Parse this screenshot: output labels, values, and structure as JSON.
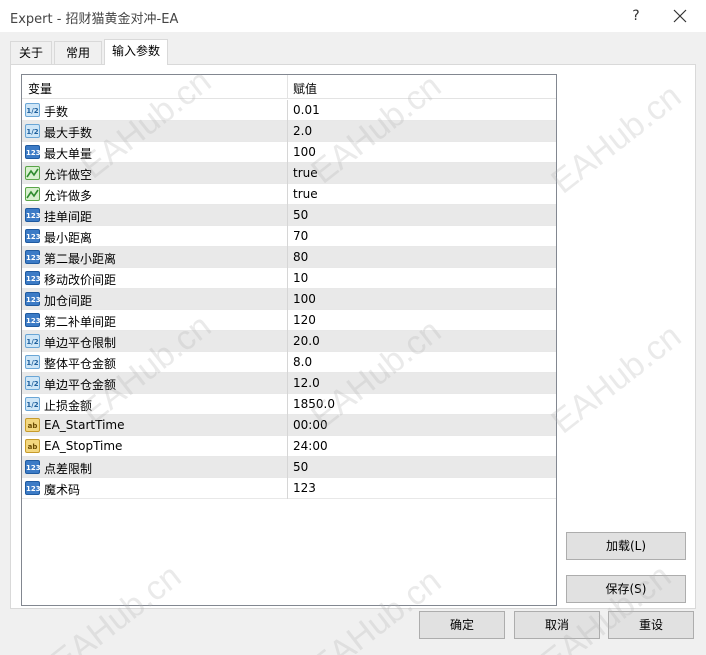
{
  "window": {
    "title": "Expert - 招财猫黄金对冲-EA",
    "help": "?"
  },
  "tabs": [
    {
      "label": "关于"
    },
    {
      "label": "常用"
    },
    {
      "label": "输入参数"
    }
  ],
  "grid": {
    "col_variable": "变量",
    "col_value": "赋值",
    "rows": [
      {
        "name": "手数",
        "value": "0.01",
        "type": "double"
      },
      {
        "name": "最大手数",
        "value": "2.0",
        "type": "double"
      },
      {
        "name": "最大单量",
        "value": "100",
        "type": "int"
      },
      {
        "name": "允许做空",
        "value": "true",
        "type": "bool"
      },
      {
        "name": "允许做多",
        "value": "true",
        "type": "bool"
      },
      {
        "name": "挂单间距",
        "value": "50",
        "type": "int"
      },
      {
        "name": "最小距离",
        "value": "70",
        "type": "int"
      },
      {
        "name": "第二最小距离",
        "value": "80",
        "type": "int"
      },
      {
        "name": "移动改价间距",
        "value": "10",
        "type": "int"
      },
      {
        "name": "加仓间距",
        "value": "100",
        "type": "int"
      },
      {
        "name": "第二补单间距",
        "value": "120",
        "type": "int"
      },
      {
        "name": "单边平仓限制",
        "value": "20.0",
        "type": "double"
      },
      {
        "name": "整体平仓金额",
        "value": "8.0",
        "type": "double"
      },
      {
        "name": "单边平仓金额",
        "value": "12.0",
        "type": "double"
      },
      {
        "name": "止损金额",
        "value": "1850.0",
        "type": "double"
      },
      {
        "name": "EA_StartTime",
        "value": "00:00",
        "type": "string"
      },
      {
        "name": "EA_StopTime",
        "value": "24:00",
        "type": "string"
      },
      {
        "name": "点差限制",
        "value": "50",
        "type": "int"
      },
      {
        "name": "魔术码",
        "value": "123",
        "type": "int"
      }
    ]
  },
  "icons": {
    "double": "1/2",
    "int": "123",
    "string": "ab"
  },
  "buttons": {
    "load": "加载(L)",
    "save": "保存(S)",
    "ok": "确定",
    "cancel": "取消",
    "reset": "重设"
  },
  "watermark": "EAHub.cn",
  "colors": {
    "alt_row": "#e9e9e9",
    "button_bg": "#e1e1e1"
  }
}
